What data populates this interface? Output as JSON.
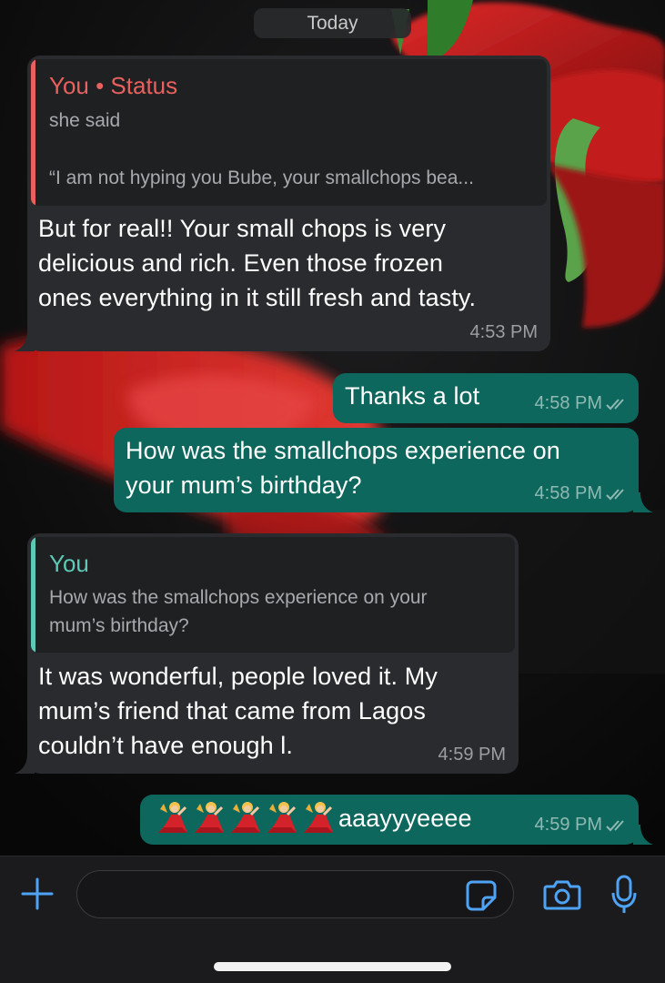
{
  "chat": {
    "date_label": "Today",
    "messages": [
      {
        "direction": "incoming",
        "quote": {
          "title": "You • Status",
          "line1": "she said",
          "line2": "“I am not hyping you Bube, your smallchops bea..."
        },
        "lines": [
          "But for real!! Your small chops is very",
          "delicious and rich. Even those frozen",
          "ones everything in it still fresh and tasty."
        ],
        "time": "4:53 PM"
      },
      {
        "direction": "outgoing",
        "lines": [
          "Thanks a lot"
        ],
        "time": "4:58 PM",
        "status": "read"
      },
      {
        "direction": "outgoing",
        "lines": [
          "How was the smallchops experience on",
          "your mum’s birthday?"
        ],
        "time": "4:58 PM",
        "status": "read"
      },
      {
        "direction": "incoming",
        "quote": {
          "title": "You",
          "line1": "How was the smallchops experience on your",
          "line2": "mum’s birthday?"
        },
        "lines": [
          "It was wonderful, people loved it. My",
          "mum’s friend that came from Lagos",
          "couldn’t have enough l."
        ],
        "time": "4:59 PM"
      },
      {
        "direction": "outgoing",
        "emojis": [
          "woman-dancing-emoji",
          "woman-dancing-emoji",
          "woman-dancing-emoji",
          "woman-dancing-emoji",
          "woman-dancing-emoji"
        ],
        "text": "aaayyyeeee",
        "time": "4:59 PM",
        "status": "read"
      }
    ]
  },
  "input_bar": {
    "placeholder": "",
    "icons": [
      "plus-icon",
      "sticker-icon",
      "camera-icon",
      "microphone-icon"
    ]
  },
  "colors": {
    "incoming_bubble": "#2a2b2e",
    "outgoing_bubble": "#0e675c",
    "status_quote_accent": "#e8615f",
    "reply_quote_accent": "#5fc9b8",
    "accent_blue": "#4ea3f5"
  }
}
